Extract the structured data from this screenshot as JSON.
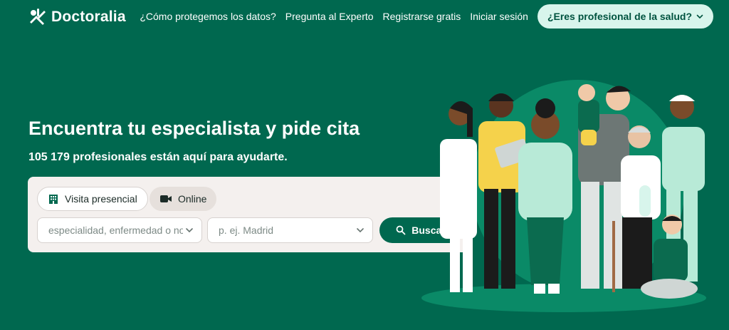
{
  "brand": {
    "name": "Doctoralia"
  },
  "nav": {
    "links": [
      "¿Cómo protegemos los datos?",
      "Pregunta al Experto",
      "Registrarse gratis",
      "Iniciar sesión"
    ],
    "pro_button": "¿Eres profesional de la salud?"
  },
  "hero": {
    "title": "Encuentra tu especialista y pide cita",
    "subtitle": "105 179 profesionales están aquí para ayudarte."
  },
  "search": {
    "tabs": [
      {
        "label": "Visita presencial",
        "icon": "building-icon",
        "selected": true
      },
      {
        "label": "Online",
        "icon": "video-camera-icon",
        "selected": false
      }
    ],
    "specialty_placeholder": "especialidad, enfermedad o nombre",
    "location_placeholder": "p. ej. Madrid",
    "button": "Buscar"
  },
  "colors": {
    "background": "#00684f",
    "accent_light": "#d8f5ec",
    "card": "#f4f0ee"
  }
}
